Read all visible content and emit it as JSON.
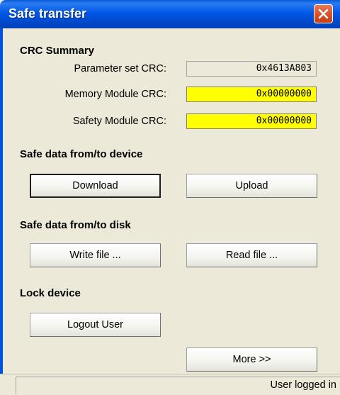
{
  "window": {
    "title": "Safe transfer",
    "close_icon": "close-icon"
  },
  "crc_summary": {
    "heading": "CRC Summary",
    "rows": [
      {
        "label": "Parameter set CRC:",
        "value": "0x4613A803",
        "color": "#ece9d8"
      },
      {
        "label": "Memory Module CRC:",
        "value": "0x00000000",
        "color": "#ffff00"
      },
      {
        "label": "Safety Module CRC:",
        "value": "0x00000000",
        "color": "#ffff00"
      }
    ]
  },
  "device_section": {
    "heading": "Safe data from/to device",
    "download_label": "Download",
    "upload_label": "Upload"
  },
  "disk_section": {
    "heading": "Safe data from/to disk",
    "write_label": "Write file ...",
    "read_label": "Read file ..."
  },
  "lock_section": {
    "heading": "Lock device",
    "logout_label": "Logout User"
  },
  "more_label": "More >>",
  "status_bar": {
    "text": "User logged in"
  }
}
